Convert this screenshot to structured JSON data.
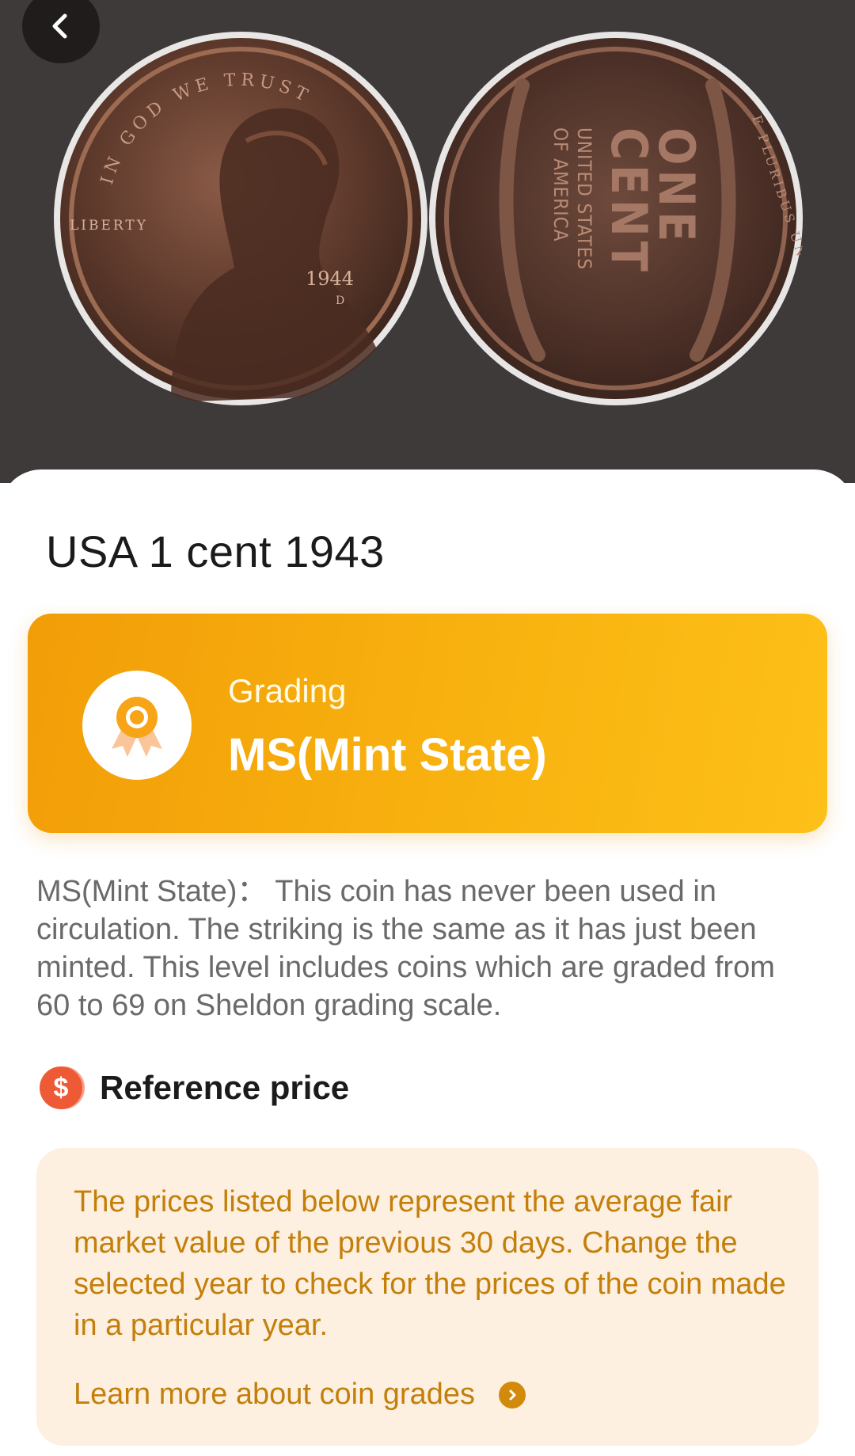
{
  "header": {
    "back_icon": "chevron-left-icon"
  },
  "coin_images": {
    "front": {
      "legend_top": "IN GOD WE TRUST",
      "legend_left": "LIBERTY",
      "year": "1944",
      "mint_mark": "D"
    },
    "back": {
      "denomination_line1": "ONE",
      "denomination_line2": "CENT",
      "country_line1": "UNITED STATES",
      "country_line2": "OF AMERICA",
      "motto": "E PLURIBUS UNUM"
    }
  },
  "coin": {
    "title": "USA 1 cent 1943"
  },
  "grading": {
    "label": "Grading",
    "value": "MS(Mint State)",
    "icon": "award-ribbon-icon",
    "color_start": "#f29d08",
    "color_end": "#fdc018"
  },
  "description": "MS(Mint State)： This coin has never been used in circulation. The striking is the same as it has just been minted. This level includes coins which are graded from 60 to 69 on Sheldon grading scale.",
  "reference_price": {
    "title": "Reference price",
    "icon": "dollar-coin-icon",
    "icon_symbol": "$",
    "info_text": "The prices listed below represent the average fair market value of the previous 30 days. Change the selected year to check for the prices of the coin made in a particular year.",
    "learn_more": "Learn more about coin grades",
    "accent_color": "#c47f0a"
  }
}
